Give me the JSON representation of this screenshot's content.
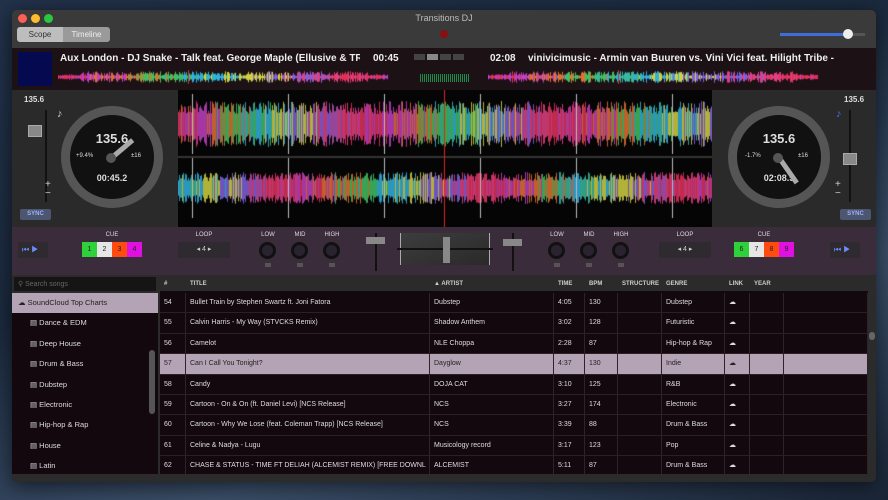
{
  "window": {
    "title": "Transitions DJ",
    "volume": 0.8
  },
  "view_tabs": [
    {
      "label": "Scope",
      "active": true
    },
    {
      "label": "Timeline",
      "active": false
    }
  ],
  "deck_left": {
    "track": "Aux London - DJ Snake - Talk feat. George Maple (Ellusive & TRIN",
    "elapsed": "00:45",
    "bpm": "135.6",
    "pitch": "+9.4%",
    "range": "±16",
    "time": "00:45.2",
    "sync": "SYNC"
  },
  "deck_right": {
    "track": "vinivicimusic - Armin van Buuren vs. Vini Vici feat. Hilight Tribe -",
    "elapsed": "02:08",
    "bpm": "135.6",
    "pitch": "-1.7%",
    "range": "±16",
    "time": "02:08.5",
    "sync": "SYNC"
  },
  "mixer": {
    "cue_label": "CUE",
    "loop_label": "LOOP",
    "loop_value": "4",
    "eq": [
      "LOW",
      "MID",
      "HIGH"
    ],
    "cues_left": [
      {
        "n": "1",
        "c": "#2fd13a"
      },
      {
        "n": "2",
        "c": "#e6e6e6"
      },
      {
        "n": "3",
        "c": "#ff4a10"
      },
      {
        "n": "4",
        "c": "#e010e0"
      }
    ],
    "cues_right": [
      {
        "n": "6",
        "c": "#2fd13a"
      },
      {
        "n": "7",
        "c": "#e6e6e6"
      },
      {
        "n": "8",
        "c": "#ff4a10"
      },
      {
        "n": "9",
        "c": "#e010e0"
      }
    ]
  },
  "library": {
    "search_placeholder": "Search songs",
    "sidebar": [
      {
        "label": "SoundCloud Top Charts",
        "icon": "cloud-icon",
        "selected": true
      },
      {
        "label": "Dance & EDM"
      },
      {
        "label": "Deep House"
      },
      {
        "label": "Drum & Bass"
      },
      {
        "label": "Dubstep"
      },
      {
        "label": "Electronic"
      },
      {
        "label": "Hip-hop & Rap"
      },
      {
        "label": "House"
      },
      {
        "label": "Latin"
      }
    ],
    "columns": [
      "#",
      "TITLE",
      "▲ ARTIST",
      "TIME",
      "BPM",
      "STRUCTURE",
      "GENRE",
      "LINK",
      "YEAR"
    ],
    "rows": [
      [
        "54",
        "Bullet Train by Stephen Swartz ft. Joni Fatora",
        "Dubstep",
        "4:05",
        "130",
        "",
        "Dubstep"
      ],
      [
        "55",
        "Calvin Harris - My Way (STVCKS Remix)",
        "Shadow Anthem",
        "3:02",
        "128",
        "",
        "Futuristic"
      ],
      [
        "56",
        "Camelot",
        "NLE Choppa",
        "2:28",
        "87",
        "",
        "Hip-hop & Rap"
      ],
      [
        "57",
        "Can I Call You Tonight?",
        "Dayglow",
        "4:37",
        "130",
        "",
        "Indie"
      ],
      [
        "58",
        "Candy",
        "DOJA CAT",
        "3:10",
        "125",
        "",
        "R&B"
      ],
      [
        "59",
        "Cartoon - On & On (ft. Daniel Levi) [NCS Release]",
        "NCS",
        "3:27",
        "174",
        "",
        "Electronic"
      ],
      [
        "60",
        "Cartoon - Why We Lose (feat. Coleman Trapp) [NCS Release]",
        "NCS",
        "3:39",
        "88",
        "",
        "Drum & Bass"
      ],
      [
        "61",
        "Celine & Nadya - Lugu",
        "Musicology record",
        "3:17",
        "123",
        "",
        "Pop"
      ],
      [
        "62",
        "CHASE & STATUS - TIME FT DELIAH (ALCEMIST REMIX) [FREE DOWNL",
        "ALCEMIST",
        "5:11",
        "87",
        "",
        "Drum & Bass"
      ]
    ],
    "selected_row": 3
  }
}
